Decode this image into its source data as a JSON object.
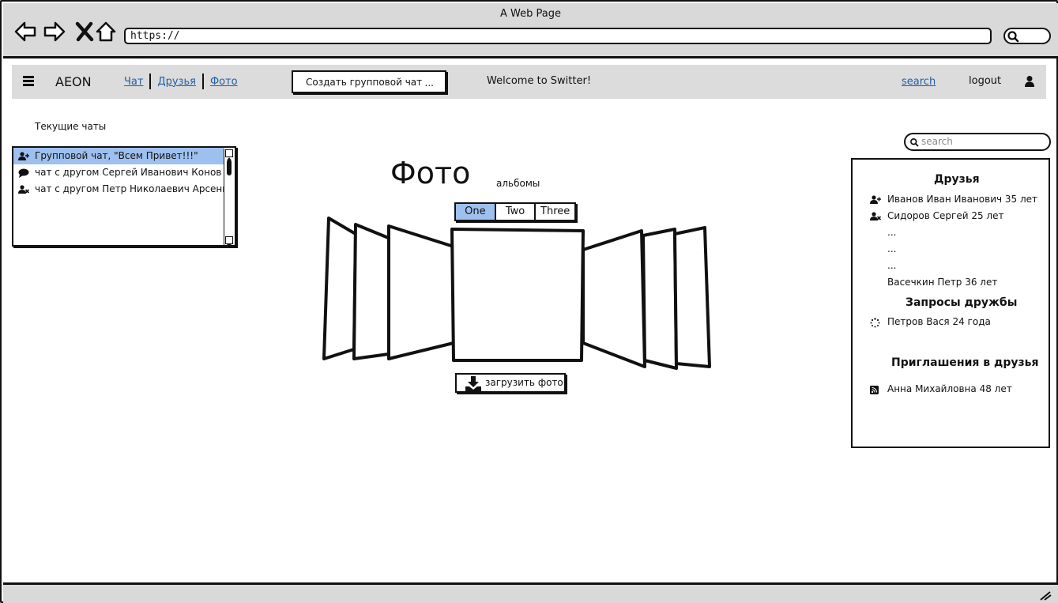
{
  "window": {
    "title": "A Web Page",
    "url": "https://"
  },
  "appbar": {
    "brand": "AEON",
    "nav": [
      {
        "label": "Чат"
      },
      {
        "label": "Друзья"
      },
      {
        "label": "Фото"
      }
    ],
    "group_button": {
      "label": "Создать групповой чат",
      "more": "..."
    },
    "welcome": "Welcome to Switter!",
    "search_link": "search",
    "logout": "logout"
  },
  "chats": {
    "title": "Текущие чаты",
    "items": [
      {
        "label": "Групповой чат, \"Всем Привет!!!\"",
        "icon": "add-user-icon",
        "selected": true
      },
      {
        "label": "чат с другом Сергей Иванович Конов",
        "icon": "comment-icon",
        "selected": false
      },
      {
        "label": "чат с другом Петр Николаевич Арсеньев",
        "icon": "remove-user-icon",
        "selected": false
      }
    ]
  },
  "photos": {
    "title": "Фото",
    "albums_label": "альбомы",
    "tabs": [
      {
        "label": "One",
        "active": true
      },
      {
        "label": "Two",
        "active": false
      },
      {
        "label": "Three",
        "active": false
      }
    ],
    "upload_button": "загрузить фото"
  },
  "right": {
    "search_placeholder": "search",
    "friends_title": "Друзья",
    "friends": [
      {
        "label": "Иванов Иван Иванович 35 лет",
        "icon": "add-user-icon"
      },
      {
        "label": "Сидоров Сергей  25 лет",
        "icon": "remove-user-icon"
      },
      {
        "label": "...",
        "icon": ""
      },
      {
        "label": "...",
        "icon": ""
      },
      {
        "label": "...",
        "icon": ""
      },
      {
        "label": "Васечкин Петр 36 лет",
        "icon": ""
      }
    ],
    "requests_title": "Запросы дружбы",
    "requests": [
      {
        "label": "Петров Вася 24 года",
        "icon": "spinner-icon"
      }
    ],
    "invites_title": "Приглашения в друзья",
    "invites": [
      {
        "label": "Анна Михайловна 48 лет",
        "icon": "rss-icon"
      }
    ]
  },
  "colors": {
    "selection": "#9ec0ee",
    "chrome": "#d9d9d9",
    "link": "#1f5fa6"
  }
}
